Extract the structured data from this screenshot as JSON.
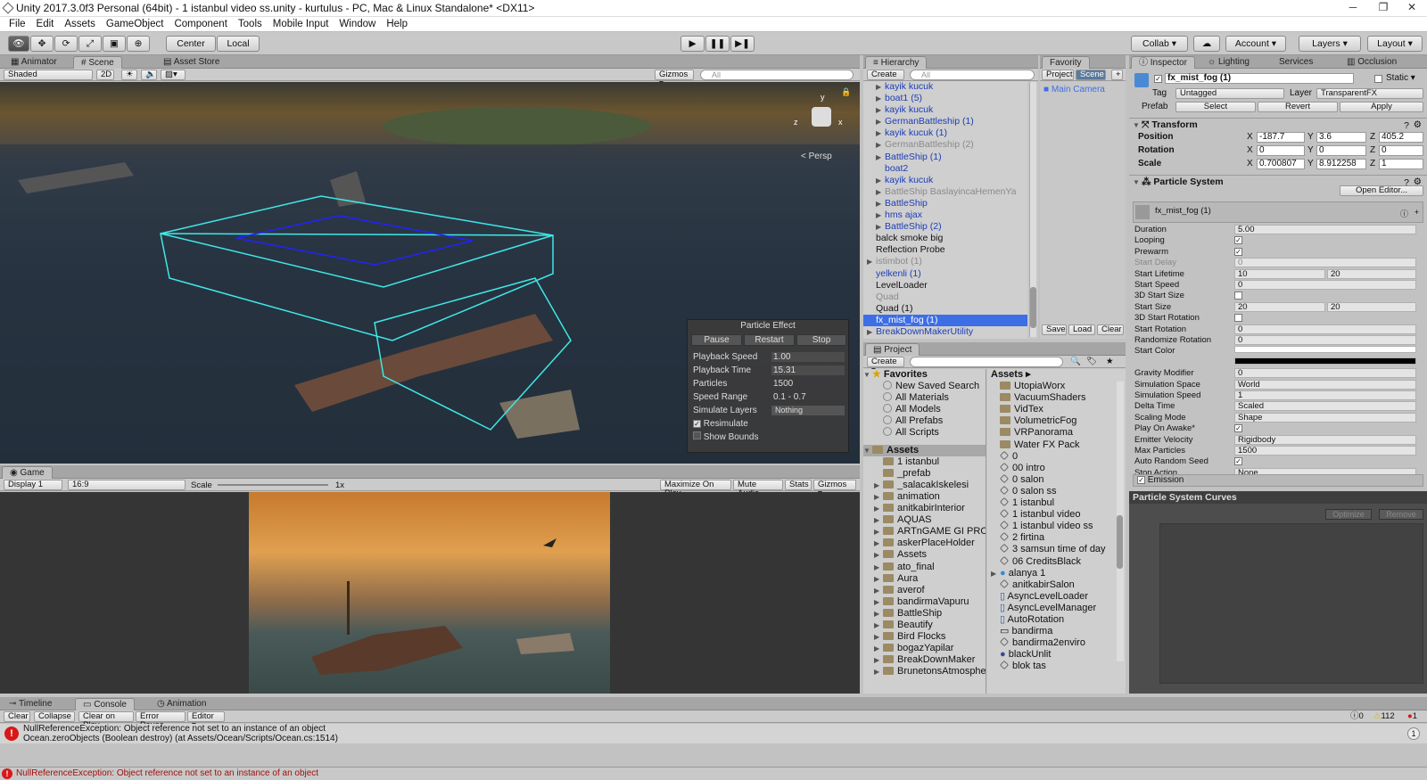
{
  "window": {
    "title": "Unity 2017.3.0f3 Personal (64bit) - 1 istanbul video ss.unity - kurtulus - PC, Mac & Linux Standalone* <DX11>",
    "minimize": "─",
    "maximize": "❐",
    "close": "✕"
  },
  "menu": [
    "File",
    "Edit",
    "Assets",
    "GameObject",
    "Component",
    "Tools",
    "Mobile Input",
    "Window",
    "Help"
  ],
  "toolbar": {
    "center": "Center",
    "local": "Local",
    "play": "▶",
    "pause": "❚❚",
    "step": "▶❚",
    "collab": "Collab ▾",
    "account": "Account ▾",
    "layers": "Layers ▾",
    "layout": "Layout ▾"
  },
  "scene": {
    "tabs": [
      "Animator",
      "Scene",
      "Asset Store"
    ],
    "shading": "Shaded",
    "mode2d": "2D",
    "gizmos": "Gizmos ▾",
    "search_placeholder": "All",
    "persp": "Persp",
    "axis": {
      "x": "x",
      "y": "y",
      "z": "z"
    },
    "particle_effect": {
      "title": "Particle Effect",
      "buttons": [
        "Pause",
        "Restart",
        "Stop"
      ],
      "rows": [
        {
          "label": "Playback Speed",
          "value": "1.00"
        },
        {
          "label": "Playback Time",
          "value": "15.31"
        },
        {
          "label": "Particles",
          "value": "1500"
        },
        {
          "label": "Speed Range",
          "value": "0.1 - 0.7"
        },
        {
          "label": "Simulate Layers",
          "value": "Nothing"
        }
      ],
      "resimulate": "Resimulate",
      "show_bounds": "Show Bounds"
    }
  },
  "game": {
    "tab": "Game",
    "display": "Display 1",
    "aspect": "16:9",
    "scale_label": "Scale",
    "scale_value": "1x",
    "buttons": [
      "Maximize On Play",
      "Mute Audio",
      "Stats",
      "Gizmos ▾"
    ]
  },
  "hierarchy": {
    "tab": "Hierarchy",
    "create": "Create ▾",
    "search_placeholder": "All",
    "items": [
      {
        "label": "kayik kucuk",
        "style": "blue",
        "tri": "▶",
        "indent": 1
      },
      {
        "label": "boat1 (5)",
        "style": "blue",
        "tri": "▶",
        "indent": 1
      },
      {
        "label": "kayik kucuk",
        "style": "blue",
        "tri": "▶",
        "indent": 1
      },
      {
        "label": "GermanBattleship (1)",
        "style": "blue",
        "tri": "▶",
        "indent": 1
      },
      {
        "label": "kayik kucuk (1)",
        "style": "blue",
        "tri": "▶",
        "indent": 1
      },
      {
        "label": "GermanBattleship (2)",
        "style": "gray",
        "tri": "▶",
        "indent": 1
      },
      {
        "label": "BattleShip (1)",
        "style": "blue",
        "tri": "▶",
        "indent": 1
      },
      {
        "label": "boat2",
        "style": "blue",
        "tri": "",
        "indent": 1
      },
      {
        "label": "kayik kucuk",
        "style": "blue",
        "tri": "▶",
        "indent": 1
      },
      {
        "label": "BattleShip BaslayincaHemenYa",
        "style": "gray",
        "tri": "▶",
        "indent": 1
      },
      {
        "label": "BattleShip",
        "style": "blue",
        "tri": "▶",
        "indent": 1
      },
      {
        "label": "hms ajax",
        "style": "blue",
        "tri": "▶",
        "indent": 1
      },
      {
        "label": "BattleShip (2)",
        "style": "blue",
        "tri": "▶",
        "indent": 1
      },
      {
        "label": "balck smoke big",
        "style": "",
        "tri": "",
        "indent": 0
      },
      {
        "label": "Reflection Probe",
        "style": "",
        "tri": "",
        "indent": 0
      },
      {
        "label": "istimbot (1)",
        "style": "gray",
        "tri": "▶",
        "indent": 0
      },
      {
        "label": "yelkenli (1)",
        "style": "blue",
        "tri": "",
        "indent": 0
      },
      {
        "label": "LevelLoader",
        "style": "",
        "tri": "",
        "indent": 0
      },
      {
        "label": "Quad",
        "style": "gray",
        "tri": "",
        "indent": 0
      },
      {
        "label": "Quad (1)",
        "style": "",
        "tri": "",
        "indent": 0
      },
      {
        "label": "fx_mist_fog (1)",
        "style": "sel",
        "tri": "",
        "indent": 0
      },
      {
        "label": "BreakDownMakerUtility",
        "style": "blue",
        "tri": "▶",
        "indent": 0
      }
    ]
  },
  "favority": {
    "tab": "Favority",
    "tabs": [
      "Project",
      "Scene"
    ],
    "item": "Main Camera",
    "buttons": [
      "Save",
      "Load",
      "Clear"
    ]
  },
  "project": {
    "tab": "Project",
    "create": "Create ▾",
    "favorites_label": "Favorites",
    "favorites": [
      "New Saved Search",
      "All Materials",
      "All Models",
      "All Prefabs",
      "All Scripts"
    ],
    "assets_label": "Assets",
    "folders": [
      "1 istanbul",
      "_prefab",
      "_salacakIskelesi",
      "animation",
      "anitkabirInterior",
      "AQUAS",
      "ARTnGAME GI PROX",
      "askerPlaceHolder",
      "Assets",
      "ato_final",
      "Aura",
      "averof",
      "bandirmaVapuru",
      "BattleShip",
      "Beautify",
      "Bird Flocks",
      "bogazYapilar",
      "BreakDownMaker",
      "BrunetonsAtmosphe"
    ],
    "breadcrumb": "Assets ▸",
    "assets": [
      {
        "label": "UtopiaWorx",
        "type": "folder"
      },
      {
        "label": "VacuumShaders",
        "type": "folder"
      },
      {
        "label": "VidTex",
        "type": "folder"
      },
      {
        "label": "VolumetricFog",
        "type": "folder"
      },
      {
        "label": "VRPanorama",
        "type": "folder"
      },
      {
        "label": "Water FX Pack",
        "type": "folder"
      },
      {
        "label": "0",
        "type": "scene"
      },
      {
        "label": "00 intro",
        "type": "scene"
      },
      {
        "label": "0 salon",
        "type": "scene"
      },
      {
        "label": "0 salon ss",
        "type": "scene"
      },
      {
        "label": "1 istanbul",
        "type": "scene"
      },
      {
        "label": "1 istanbul video",
        "type": "scene"
      },
      {
        "label": "1 istanbul video ss",
        "type": "scene"
      },
      {
        "label": "2 firtina",
        "type": "scene"
      },
      {
        "label": "3 samsun time of day",
        "type": "scene"
      },
      {
        "label": "06 CreditsBlack",
        "type": "scene"
      },
      {
        "label": "alanya 1",
        "type": "model"
      },
      {
        "label": "anitkabirSalon",
        "type": "scene"
      },
      {
        "label": "AsyncLevelLoader",
        "type": "script"
      },
      {
        "label": "AsyncLevelManager",
        "type": "script"
      },
      {
        "label": "AutoRotation",
        "type": "script"
      },
      {
        "label": "bandirma",
        "type": "doc"
      },
      {
        "label": "bandirma2enviro",
        "type": "scene"
      },
      {
        "label": "blackUnlit",
        "type": "material"
      },
      {
        "label": "blok tas",
        "type": "scene"
      }
    ]
  },
  "inspector": {
    "tabs": [
      "Inspector",
      "Lighting",
      "Services",
      "Occlusion"
    ],
    "object_name": "fx_mist_fog (1)",
    "static": "Static",
    "tag_label": "Tag",
    "tag": "Untagged",
    "layer_label": "Layer",
    "layer": "TransparentFX",
    "prefab_label": "Prefab",
    "prefab_buttons": [
      "Select",
      "Revert",
      "Apply"
    ],
    "transform": {
      "title": "Transform",
      "position": {
        "label": "Position",
        "x": "-187.7",
        "y": "3.6",
        "z": "405.2"
      },
      "rotation": {
        "label": "Rotation",
        "x": "0",
        "y": "0",
        "z": "0"
      },
      "scale": {
        "label": "Scale",
        "x": "0.700807",
        "y": "8.912258",
        "z": "1"
      }
    },
    "ps_title": "Particle System",
    "open_editor": "Open Editor...",
    "ps_name": "fx_mist_fog (1)",
    "ps_rows": [
      {
        "label": "Duration",
        "value": "5.00"
      },
      {
        "label": "Looping",
        "check": "✓"
      },
      {
        "label": "Prewarm",
        "check": "✓"
      },
      {
        "label": "Start Delay",
        "value": "0",
        "dim": true
      },
      {
        "label": "Start Lifetime",
        "value": "10",
        "value2": "20"
      },
      {
        "label": "Start Speed",
        "value": "0"
      },
      {
        "label": "3D Start Size",
        "check": ""
      },
      {
        "label": "Start Size",
        "value": "20",
        "value2": "20"
      },
      {
        "label": "3D Start Rotation",
        "check": ""
      },
      {
        "label": "Start Rotation",
        "value": "0"
      },
      {
        "label": "Randomize Rotation",
        "value": "0"
      },
      {
        "label": "Start Color",
        "value": ""
      },
      {
        "label": "",
        "value": ""
      },
      {
        "label": "Gravity Modifier",
        "value": "0"
      },
      {
        "label": "Simulation Space",
        "value": "World"
      },
      {
        "label": "Simulation Speed",
        "value": "1"
      },
      {
        "label": "Delta Time",
        "value": "Scaled"
      },
      {
        "label": "Scaling Mode",
        "value": "Shape"
      },
      {
        "label": "Play On Awake*",
        "check": "✓"
      },
      {
        "label": "Emitter Velocity",
        "value": "Rigidbody"
      },
      {
        "label": "Max Particles",
        "value": "1500"
      },
      {
        "label": "Auto Random Seed",
        "check": "✓"
      },
      {
        "label": "Stop Action",
        "value": "None"
      }
    ],
    "emission": "Emission",
    "curves_title": "Particle System Curves",
    "curve_buttons": [
      "Optimize",
      "Remove"
    ]
  },
  "console": {
    "tabs": [
      "Timeline",
      "Console",
      "Animation"
    ],
    "buttons": [
      "Clear",
      "Collapse",
      "Clear on Play",
      "Error Pause",
      "Editor ▾"
    ],
    "counts": {
      "info": "0",
      "warn": "112",
      "error": "1"
    },
    "msg1": "NullReferenceException: Object reference not set to an instance of an object",
    "msg2": "Ocean.zeroObjects (Boolean destroy) (at Assets/Ocean/Scripts/Ocean.cs:1514)",
    "msg_count": "1",
    "status": "NullReferenceException: Object reference not set to an instance of an object"
  },
  "colors": {
    "selection": "#3d6ee6",
    "prefab_blue": "#1d3db5",
    "error": "#d81818",
    "warn": "#e6b800"
  }
}
